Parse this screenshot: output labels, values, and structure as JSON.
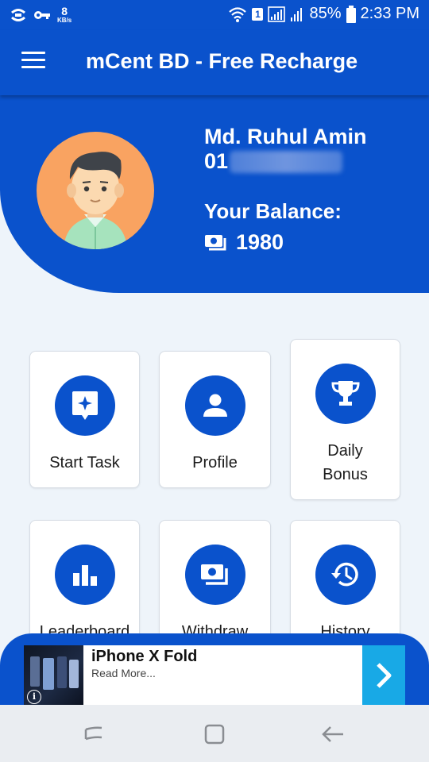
{
  "status_bar": {
    "speed_value": "8",
    "speed_unit": "KB/s",
    "sim": "1",
    "battery": "85%",
    "time": "2:33 PM"
  },
  "app_bar": {
    "title": "mCent BD - Free Recharge"
  },
  "profile": {
    "name": "Md. Ruhul Amin",
    "phone_prefix": "01",
    "balance_label": "Your Balance:",
    "balance": "1980"
  },
  "tiles": [
    {
      "label": "Start Task",
      "icon": "task-star-icon"
    },
    {
      "label": "Profile",
      "icon": "person-icon"
    },
    {
      "label": "Daily Bonus",
      "icon": "trophy-icon"
    },
    {
      "label": "Leaderboard",
      "icon": "bar-chart-icon"
    },
    {
      "label": "Withdraw",
      "icon": "money-icon"
    },
    {
      "label": "History",
      "icon": "history-icon"
    }
  ],
  "ad": {
    "title": "iPhone X Fold",
    "subtitle": "Read More..."
  },
  "colors": {
    "primary": "#0a52cc",
    "background": "#eef4fa",
    "ad_arrow": "#18a9e6",
    "avatar_bg": "#f9a361"
  }
}
